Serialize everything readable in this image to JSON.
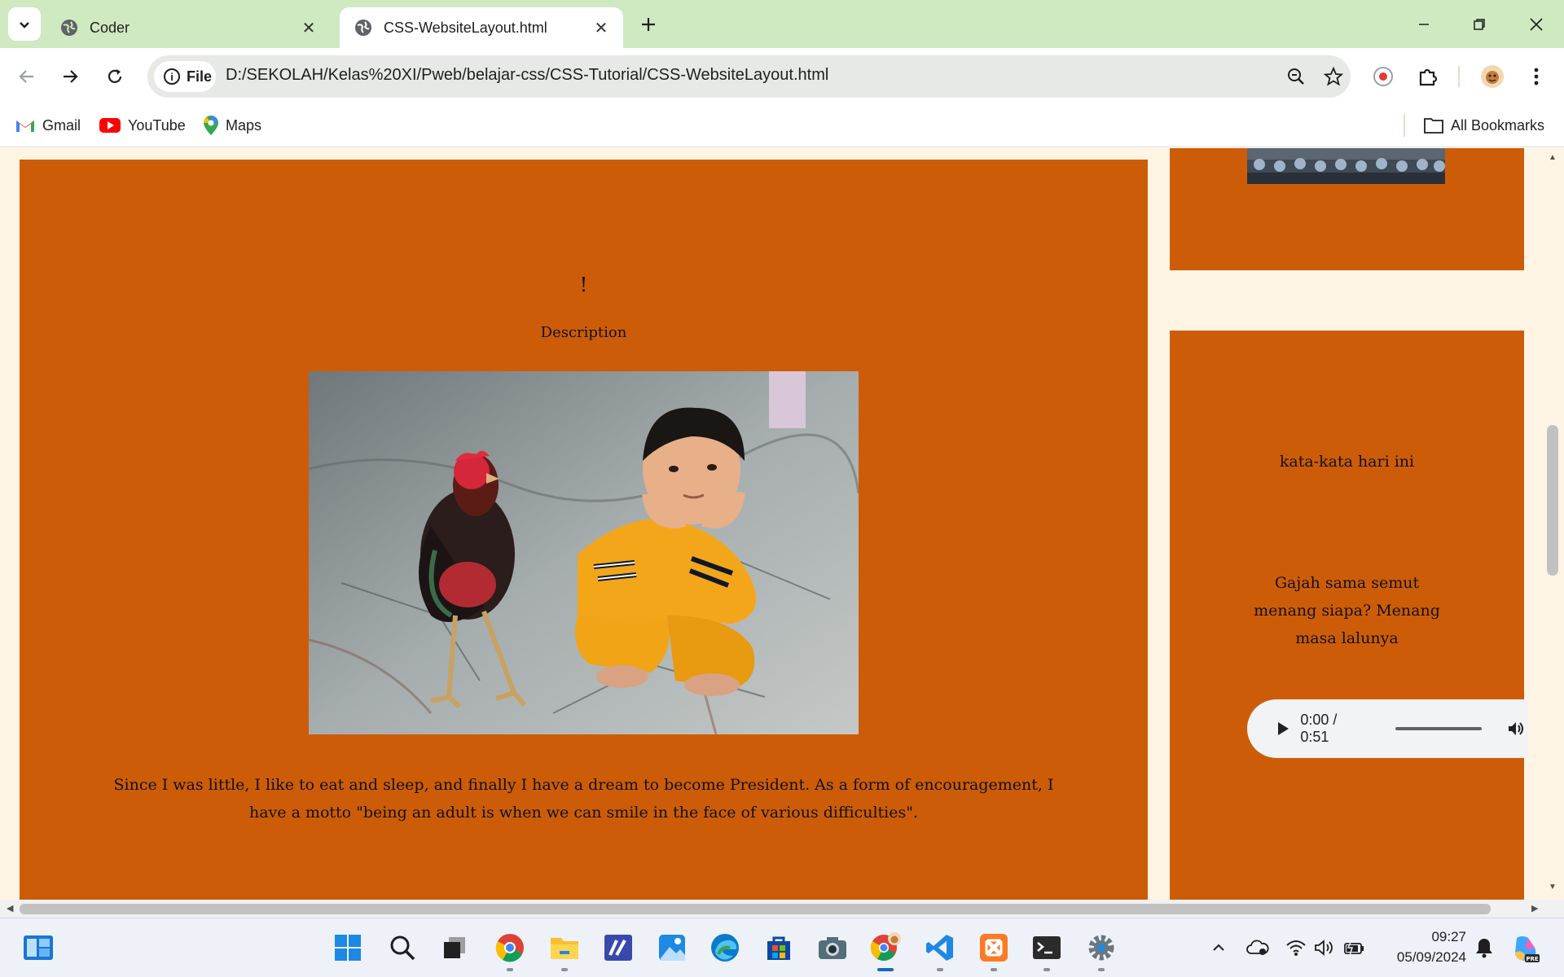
{
  "browser": {
    "tabs": [
      {
        "title": "Coder",
        "active": false
      },
      {
        "title": "CSS-WebsiteLayout.html",
        "active": true
      }
    ],
    "chip_label": "File",
    "url": "D:/SEKOLAH/Kelas%20XI/Pweb/belajar-css/CSS-Tutorial/CSS-WebsiteLayout.html",
    "bookmarks": [
      {
        "label": "Gmail",
        "icon": "gmail-icon"
      },
      {
        "label": "YouTube",
        "icon": "youtube-icon"
      },
      {
        "label": "Maps",
        "icon": "maps-icon"
      }
    ],
    "all_bookmarks_label": "All Bookmarks"
  },
  "page": {
    "main": {
      "heading": "!",
      "description": "Description",
      "image_alt": "Boy crouching next to a rooster",
      "paragraph": "Since I was little, I like to eat and sleep, and finally I have a dream to become President. As a form of encouragement, I have a motto \"being an adult is when we can smile in the face of various difficulties\"."
    },
    "sidebar": {
      "title": "kata-kata hari ini",
      "quote": "Gajah sama semut menang siapa? Menang masa lalunya",
      "audio": {
        "time": "0:00 / 0:51"
      }
    }
  },
  "taskbar": {
    "apps": [
      "widgets-icon",
      "start-icon",
      "search-icon",
      "task-view-icon",
      "chrome-icon",
      "file-explorer-icon",
      "visual-studio-icon",
      "photos-icon",
      "edge-icon",
      "store-icon",
      "camera-icon",
      "chrome-profile-icon",
      "vscode-icon",
      "xampp-icon",
      "terminal-icon",
      "settings-icon"
    ],
    "time": "09:27",
    "date": "05/09/2024"
  },
  "colors": {
    "tabstrip": "#cfe9c1",
    "page_bg": "#fdf4e3",
    "card": "#cd5c08"
  }
}
